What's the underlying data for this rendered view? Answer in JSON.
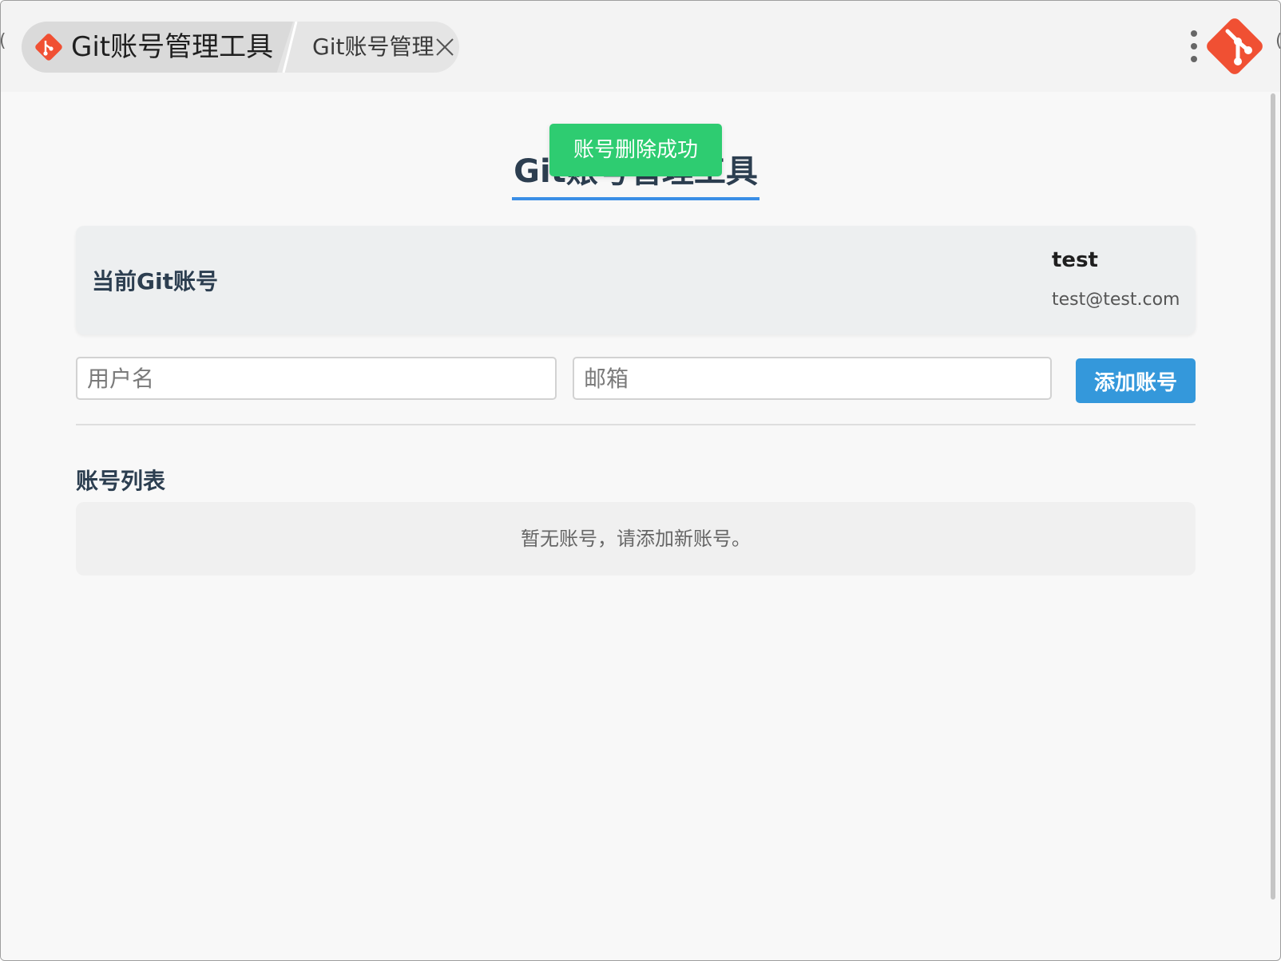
{
  "titlebar": {
    "tabs": [
      {
        "label": "Git账号管理工具",
        "icon": "git-logo-icon"
      },
      {
        "label": "Git账号管理",
        "icon": "close-icon"
      }
    ],
    "menu_icon": "more-vertical-icon",
    "app_icon": "git-logo-icon"
  },
  "main": {
    "heading": "Git账号管理工具",
    "toast": "账号删除成功",
    "current_account": {
      "title": "当前Git账号",
      "username": "test",
      "email": "test@test.com"
    },
    "form": {
      "username_placeholder": "用户名",
      "email_placeholder": "邮箱",
      "add_button": "添加账号"
    },
    "account_list": {
      "title": "账号列表",
      "empty_text": "暂无账号，请添加新账号。"
    }
  },
  "colors": {
    "brand_git": "#f05033",
    "accent": "#3498db",
    "toast_success": "#2ecc71",
    "heading": "#2c3e50"
  }
}
